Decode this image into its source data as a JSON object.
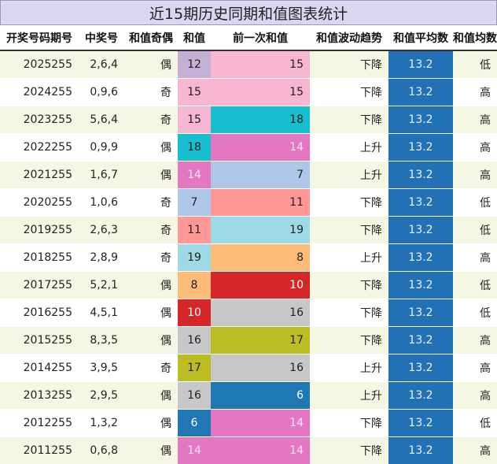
{
  "title": "近15期历史同期和值图表统计",
  "headers": [
    "开奖号码期号",
    "中奖号",
    "和值奇偶",
    "和值",
    "前一次和值",
    "和值波动趋势",
    "和值平均数",
    "和值均数趋势"
  ],
  "colors": {
    "c6": "#1f77b4",
    "c7": "#aec7e8",
    "c8": "#ffbb78",
    "c10": "#d62728",
    "c11": "#ff9896",
    "c12": "#c5b0d5",
    "c14": "#e377c2",
    "c15": "#f7b6d2",
    "c16": "#c7c7c7",
    "c17": "#bcbd22",
    "c18": "#17becf",
    "c19": "#9edae5",
    "avg_column": "#2271b4",
    "title_bar": "#dad6f2",
    "row_alt": "#f4f7e3"
  },
  "rows": [
    {
      "period": "2025255",
      "numbers": "2,6,4",
      "parity": "偶",
      "sum": 12,
      "prev": 15,
      "trend": "下降",
      "avg": "13.2",
      "avg_trend": "低"
    },
    {
      "period": "2024255",
      "numbers": "0,9,6",
      "parity": "奇",
      "sum": 15,
      "prev": 15,
      "trend": "下降",
      "avg": "13.2",
      "avg_trend": "高"
    },
    {
      "period": "2023255",
      "numbers": "5,6,4",
      "parity": "奇",
      "sum": 15,
      "prev": 18,
      "trend": "下降",
      "avg": "13.2",
      "avg_trend": "高"
    },
    {
      "period": "2022255",
      "numbers": "0,9,9",
      "parity": "偶",
      "sum": 18,
      "prev": 14,
      "trend": "上升",
      "avg": "13.2",
      "avg_trend": "高"
    },
    {
      "period": "2021255",
      "numbers": "1,6,7",
      "parity": "偶",
      "sum": 14,
      "prev": 7,
      "trend": "上升",
      "avg": "13.2",
      "avg_trend": "高"
    },
    {
      "period": "2020255",
      "numbers": "1,0,6",
      "parity": "奇",
      "sum": 7,
      "prev": 11,
      "trend": "下降",
      "avg": "13.2",
      "avg_trend": "低"
    },
    {
      "period": "2019255",
      "numbers": "2,6,3",
      "parity": "奇",
      "sum": 11,
      "prev": 19,
      "trend": "下降",
      "avg": "13.2",
      "avg_trend": "低"
    },
    {
      "period": "2018255",
      "numbers": "2,8,9",
      "parity": "奇",
      "sum": 19,
      "prev": 8,
      "trend": "上升",
      "avg": "13.2",
      "avg_trend": "高"
    },
    {
      "period": "2017255",
      "numbers": "5,2,1",
      "parity": "偶",
      "sum": 8,
      "prev": 10,
      "trend": "下降",
      "avg": "13.2",
      "avg_trend": "低"
    },
    {
      "period": "2016255",
      "numbers": "4,5,1",
      "parity": "偶",
      "sum": 10,
      "prev": 16,
      "trend": "下降",
      "avg": "13.2",
      "avg_trend": "低"
    },
    {
      "period": "2015255",
      "numbers": "8,3,5",
      "parity": "偶",
      "sum": 16,
      "prev": 17,
      "trend": "下降",
      "avg": "13.2",
      "avg_trend": "高"
    },
    {
      "period": "2014255",
      "numbers": "3,9,5",
      "parity": "奇",
      "sum": 17,
      "prev": 16,
      "trend": "上升",
      "avg": "13.2",
      "avg_trend": "高"
    },
    {
      "period": "2013255",
      "numbers": "2,9,5",
      "parity": "偶",
      "sum": 16,
      "prev": 6,
      "trend": "上升",
      "avg": "13.2",
      "avg_trend": "高"
    },
    {
      "period": "2012255",
      "numbers": "1,3,2",
      "parity": "偶",
      "sum": 6,
      "prev": 14,
      "trend": "下降",
      "avg": "13.2",
      "avg_trend": "低"
    },
    {
      "period": "2011255",
      "numbers": "0,6,8",
      "parity": "偶",
      "sum": 14,
      "prev": 14,
      "trend": "下降",
      "avg": "13.2",
      "avg_trend": "高"
    }
  ]
}
